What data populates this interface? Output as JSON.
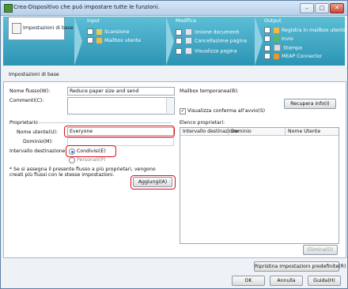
{
  "window": {
    "title": "Crea-Dispositivo che può impostare tutte le funzioni.",
    "minimize": "–",
    "maximize": "□",
    "close": "✕"
  },
  "flow": {
    "tab_label": "Impostazioni di base",
    "input": {
      "header": "Input",
      "items": [
        "Scansione",
        "Mailbox utente"
      ]
    },
    "modify": {
      "header": "Modifica",
      "items": [
        "Unione documenti",
        "Cancellazione pagina",
        "Visualizza pagina"
      ]
    },
    "output": {
      "header": "Output",
      "items": [
        "Registra in mailbox utente",
        "Invio",
        "Stampa",
        "MEAP Connector"
      ]
    }
  },
  "section_title": "Impostazioni di base",
  "form": {
    "flow_name_label": "Nome flusso(W):",
    "flow_name_value": "Reduce paper size and send",
    "comments_label": "Commenti(C):",
    "comments_value": "",
    "temp_mailbox_label": "Mailbox temporanea(B):",
    "show_confirm_label": "Visualizza conferma all'avvio(S)",
    "show_confirm_checked": "✓",
    "retrieve_info_button": "Recupera info(I)",
    "owner_group_label": "Proprietario",
    "username_label": "Nome utente(U):",
    "username_value": "Everyone",
    "domain_label": "Dominio(M):",
    "domain_value": "",
    "target_interval_label": "Intervallo destinazione:",
    "shared_label": "Condivisi(E)",
    "personal_label": "Personali(P)",
    "note": "* Se si assegna il presente flusso a più proprietari, vengono creati più flussi con le stesse impostazioni.",
    "add_button": "Aggiungi(A)",
    "owners_list_label": "Elenco proprietari:",
    "owners_columns": [
      "Intervallo destinazione",
      "Dominio",
      "Nome Utente"
    ],
    "delete_button": "Elimina(D)"
  },
  "footer": {
    "restore_defaults_button": "Ripristina impostazioni predefinite(R)",
    "ok_button": "OK",
    "cancel_button": "Annulla",
    "help_button": "Guida(H)"
  }
}
